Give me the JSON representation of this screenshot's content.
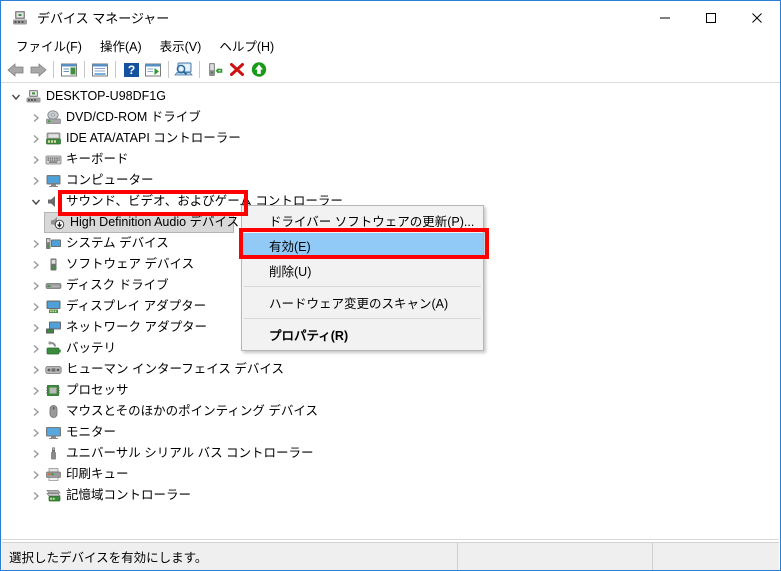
{
  "window": {
    "title": "デバイス マネージャー",
    "title_icon": "device-manager-icon",
    "controls": {
      "minimize": "minimize-icon",
      "maximize": "maximize-icon",
      "close": "close-icon"
    }
  },
  "menubar": {
    "items": [
      {
        "label": "ファイル(F)",
        "name": "menu-file"
      },
      {
        "label": "操作(A)",
        "name": "menu-action"
      },
      {
        "label": "表示(V)",
        "name": "menu-view"
      },
      {
        "label": "ヘルプ(H)",
        "name": "menu-help"
      }
    ]
  },
  "toolbar": {
    "items": [
      {
        "name": "back-icon",
        "type": "button"
      },
      {
        "name": "forward-icon",
        "type": "button"
      },
      {
        "name": "separator-1",
        "type": "separator"
      },
      {
        "name": "show-hide-console-tree-icon",
        "type": "button"
      },
      {
        "name": "separator-2",
        "type": "separator"
      },
      {
        "name": "properties-icon",
        "type": "button"
      },
      {
        "name": "separator-3",
        "type": "separator"
      },
      {
        "name": "help-icon",
        "type": "button"
      },
      {
        "name": "update-driver-icon",
        "type": "button"
      },
      {
        "name": "separator-4",
        "type": "separator"
      },
      {
        "name": "scan-hardware-changes-icon",
        "type": "button"
      },
      {
        "name": "separator-5",
        "type": "separator"
      },
      {
        "name": "uninstall-device-icon",
        "type": "button"
      },
      {
        "name": "disable-device-icon",
        "type": "button"
      },
      {
        "name": "enable-device-icon",
        "type": "button"
      }
    ]
  },
  "tree": {
    "nodes": [
      {
        "label": "DESKTOP-U98DF1G",
        "level": 0,
        "expanded": true,
        "icon": "computer-root-icon",
        "selected": false
      },
      {
        "label": "DVD/CD-ROM ドライブ",
        "level": 1,
        "expanded": false,
        "icon": "dvd-drive-icon",
        "selected": false
      },
      {
        "label": "IDE ATA/ATAPI コントローラー",
        "level": 1,
        "expanded": false,
        "icon": "ide-controller-icon",
        "selected": false
      },
      {
        "label": "キーボード",
        "level": 1,
        "expanded": false,
        "icon": "keyboard-icon",
        "selected": false
      },
      {
        "label": "コンピューター",
        "level": 1,
        "expanded": false,
        "icon": "computer-icon",
        "selected": false
      },
      {
        "label": "サウンド、ビデオ、およびゲーム コントローラー",
        "level": 1,
        "expanded": true,
        "icon": "sound-controller-icon",
        "selected": false
      },
      {
        "label": "High Definition Audio デバイス",
        "level": 2,
        "expanded": null,
        "icon": "audio-device-disabled-icon",
        "selected": true
      },
      {
        "label": "システム デバイス",
        "level": 1,
        "expanded": false,
        "icon": "system-device-icon",
        "selected": false
      },
      {
        "label": "ソフトウェア デバイス",
        "level": 1,
        "expanded": false,
        "icon": "software-device-icon",
        "selected": false
      },
      {
        "label": "ディスク ドライブ",
        "level": 1,
        "expanded": false,
        "icon": "disk-drive-icon",
        "selected": false
      },
      {
        "label": "ディスプレイ アダプター",
        "level": 1,
        "expanded": false,
        "icon": "display-adapter-icon",
        "selected": false
      },
      {
        "label": "ネットワーク アダプター",
        "level": 1,
        "expanded": false,
        "icon": "network-adapter-icon",
        "selected": false
      },
      {
        "label": "バッテリ",
        "level": 1,
        "expanded": false,
        "icon": "battery-icon",
        "selected": false
      },
      {
        "label": "ヒューマン インターフェイス デバイス",
        "level": 1,
        "expanded": false,
        "icon": "hid-icon",
        "selected": false
      },
      {
        "label": "プロセッサ",
        "level": 1,
        "expanded": false,
        "icon": "processor-icon",
        "selected": false
      },
      {
        "label": "マウスとそのほかのポインティング デバイス",
        "level": 1,
        "expanded": false,
        "icon": "mouse-icon",
        "selected": false
      },
      {
        "label": "モニター",
        "level": 1,
        "expanded": false,
        "icon": "monitor-icon",
        "selected": false
      },
      {
        "label": "ユニバーサル シリアル バス コントローラー",
        "level": 1,
        "expanded": false,
        "icon": "usb-controller-icon",
        "selected": false
      },
      {
        "label": "印刷キュー",
        "level": 1,
        "expanded": false,
        "icon": "print-queue-icon",
        "selected": false
      },
      {
        "label": "記憶域コントローラー",
        "level": 1,
        "expanded": false,
        "icon": "storage-controller-icon",
        "selected": false
      }
    ]
  },
  "context_menu": {
    "items": [
      {
        "label": "ドライバー ソフトウェアの更新(P)...",
        "name": "ctx-update-driver",
        "type": "item",
        "highlighted": false,
        "bold": false
      },
      {
        "label": "有効(E)",
        "name": "ctx-enable",
        "type": "item",
        "highlighted": true,
        "bold": false
      },
      {
        "label": "削除(U)",
        "name": "ctx-uninstall",
        "type": "item",
        "highlighted": false,
        "bold": false
      },
      {
        "label": "",
        "name": "ctx-separator-1",
        "type": "separator",
        "highlighted": false,
        "bold": false
      },
      {
        "label": "ハードウェア変更のスキャン(A)",
        "name": "ctx-scan-hardware",
        "type": "item",
        "highlighted": false,
        "bold": false
      },
      {
        "label": "",
        "name": "ctx-separator-2",
        "type": "separator",
        "highlighted": false,
        "bold": false
      },
      {
        "label": "プロパティ(R)",
        "name": "ctx-properties",
        "type": "item",
        "highlighted": false,
        "bold": true
      }
    ]
  },
  "statusbar": {
    "message": "選択したデバイスを有効にします。",
    "cell2": "",
    "cell3": ""
  },
  "annotations": [
    {
      "name": "annotation-selected-device",
      "color": "#ff0000"
    },
    {
      "name": "annotation-enable-menu-item",
      "color": "#ff0000"
    }
  ],
  "colors": {
    "window_border": "#2a7fd4",
    "menu_highlight": "#91c9f7",
    "selection": "#d8d8d8",
    "annotation": "#ff0000",
    "statusbar_bg": "#efefef"
  }
}
